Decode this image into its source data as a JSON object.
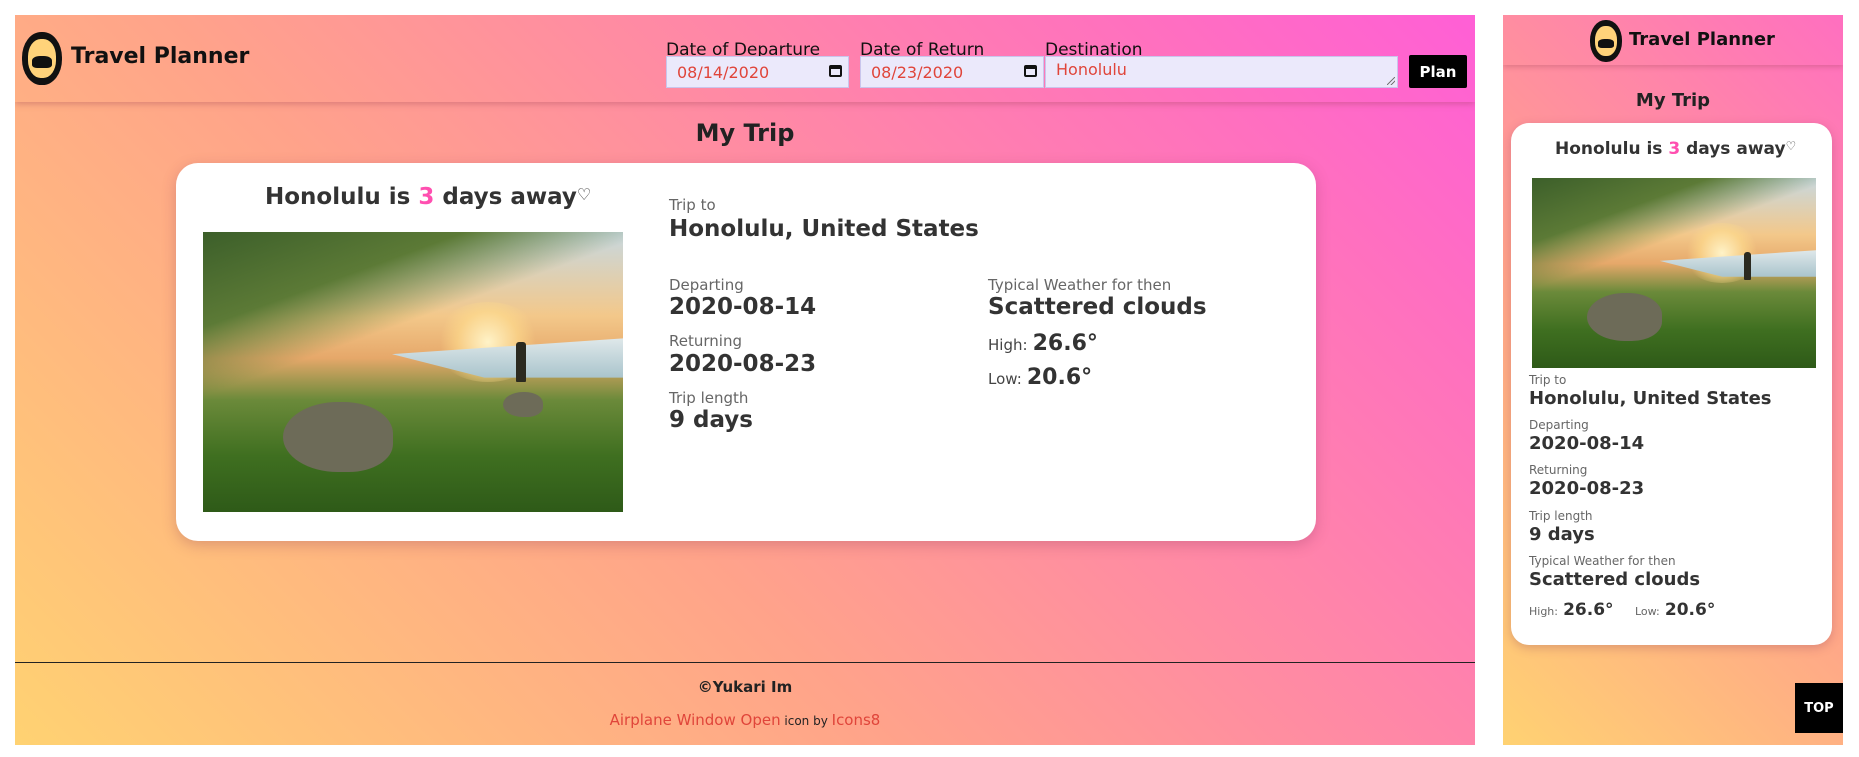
{
  "app": {
    "name": "Travel Planner"
  },
  "search": {
    "departure_label": "Date of Departure",
    "departure_value": "08/14/2020",
    "return_label": "Date of Return",
    "return_value": "08/23/2020",
    "destination_label": "Destination",
    "destination_value": "Honolulu",
    "plan_label": "Plan"
  },
  "trip": {
    "section_title": "My Trip",
    "away_prefix": "Honolulu is ",
    "days_away": "3",
    "away_suffix": " days away",
    "heart": "♡",
    "trip_to_label": "Trip to",
    "destination_full": "Honolulu, United States",
    "departing_label": "Departing",
    "departing": "2020-08-14",
    "returning_label": "Returning",
    "returning": "2020-08-23",
    "length_label": "Trip length",
    "length": "9 days",
    "weather_label": "Typical Weather for then",
    "weather": "Scattered clouds",
    "high_label": "High:",
    "high": "26.6°",
    "low_label": "Low:",
    "low": "20.6°"
  },
  "footer": {
    "copyright": "©Yukari Im",
    "icon_name": "Airplane Window Open",
    "icon_by": " icon by ",
    "icon_source": "Icons8"
  },
  "mobile": {
    "top_label": "TOP"
  },
  "colors": {
    "accent_pink": "#ff4fb0",
    "link_red": "#e0453a",
    "gradient_start": "#ffd272",
    "gradient_end": "#ff5fd6"
  }
}
